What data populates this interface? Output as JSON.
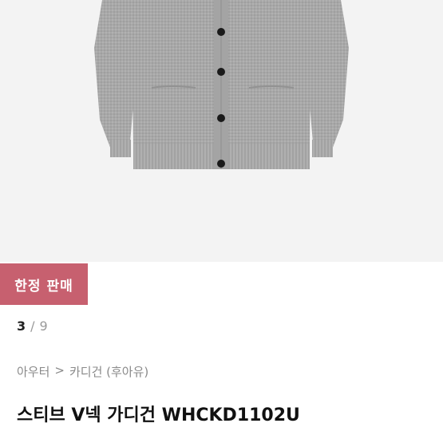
{
  "product": {
    "image_alt": "gray v-neck cardigan",
    "badge": "한정 판매",
    "pager": {
      "current": "3",
      "separator": "/",
      "total": "9"
    },
    "breadcrumb": {
      "category": "아우터",
      "separator": ">",
      "subcategory": "카디건 (후아유)"
    },
    "title": "스티브 V넥 가디건 WHCKD1102U"
  },
  "colors": {
    "badge_bg": "#c7606f",
    "hero_bg": "#f3f3f3",
    "knit": "#a9a9a9"
  }
}
